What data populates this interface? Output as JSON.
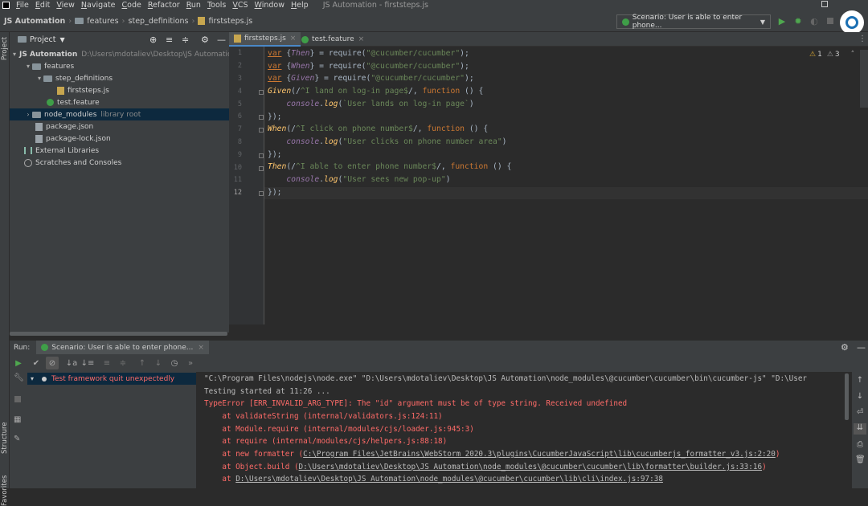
{
  "menu": [
    "File",
    "Edit",
    "View",
    "Navigate",
    "Code",
    "Refactor",
    "Run",
    "Tools",
    "VCS",
    "Window",
    "Help"
  ],
  "window_title": "JS Automation - firststeps.js",
  "breadcrumbs": [
    "JS Automation",
    "features",
    "step_definitions",
    "firststeps.js"
  ],
  "run_config": "Scenario: User is able to enter phone...",
  "project": {
    "header": "Project",
    "tree": [
      {
        "label": "JS Automation",
        "extra": "D:\\Users\\mdotaliev\\Desktop\\JS Automation",
        "type": "folder",
        "arrow": "▾",
        "indent": 0
      },
      {
        "label": "features",
        "extra": "",
        "type": "folder",
        "arrow": "▾",
        "indent": 1
      },
      {
        "label": "step_definitions",
        "extra": "",
        "type": "folder",
        "arrow": "▾",
        "indent": 2
      },
      {
        "label": "firststeps.js",
        "extra": "",
        "type": "js",
        "arrow": "",
        "indent": 3
      },
      {
        "label": "test.feature",
        "extra": "",
        "type": "feature",
        "arrow": "",
        "indent": 2
      },
      {
        "label": "node_modules",
        "extra": "library root",
        "type": "folder",
        "arrow": "›",
        "indent": 1
      },
      {
        "label": "package.json",
        "extra": "",
        "type": "json",
        "arrow": "",
        "indent": 1
      },
      {
        "label": "package-lock.json",
        "extra": "",
        "type": "json",
        "arrow": "",
        "indent": 1
      },
      {
        "label": "External Libraries",
        "extra": "",
        "type": "lib",
        "arrow": "",
        "indent": 0
      },
      {
        "label": "Scratches and Consoles",
        "extra": "",
        "type": "scratch",
        "arrow": "",
        "indent": 0
      }
    ]
  },
  "tabs": [
    {
      "label": "firststeps.js",
      "active": true
    },
    {
      "label": "test.feature",
      "active": false
    }
  ],
  "inspections": {
    "warnings": "1",
    "weak": "3"
  },
  "line_numbers": [
    "1",
    "2",
    "3",
    "4",
    "5",
    "6",
    "7",
    "8",
    "9",
    "10",
    "11",
    "12"
  ],
  "code": [
    "var {Then} = require(\"@cucumber/cucumber\");",
    "var {When} = require(\"@cucumber/cucumber\");",
    "var {Given} = require(\"@cucumber/cucumber\");",
    "Given(/^I land on log-in page$/, function () {",
    "    console.log(`User lands on log-in page`)",
    "});",
    "When(/^I click on phone number$/, function () {",
    "    console.log(\"User clicks on phone number area\")",
    "});",
    "Then(/^I able to enter phone number$/, function () {",
    "    console.log(\"User sees new pop-up\")",
    "});"
  ],
  "run": {
    "label": "Run:",
    "tab": "Scenario: User is able to enter phone...",
    "test_status": "Test framework quit unexpectedly",
    "console": [
      "\"C:\\Program Files\\nodejs\\node.exe\" \"D:\\Users\\mdotaliev\\Desktop\\JS Automation\\node_modules\\@cucumber\\cucumber\\bin\\cucumber-js\" \"D:\\User",
      "Testing started at 11:26 ...",
      "TypeError [ERR_INVALID_ARG_TYPE]: The \"id\" argument must be of type string. Received undefined",
      "    at validateString (internal/validators.js:124:11)",
      "    at Module.require (internal/modules/cjs/loader.js:945:3)",
      "    at require (internal/modules/cjs/helpers.js:88:18)",
      "    at new formatter (",
      "C:\\Program Files\\JetBrains\\WebStorm 2020.3\\plugins\\CucumberJavaScript\\lib\\cucumberjs_formatter_v3.js:2:20",
      ")",
      "    at Object.build (",
      "D:\\Users\\mdotaliev\\Desktop\\JS Automation\\node_modules\\@cucumber\\cucumber\\lib\\formatter\\builder.js:33:16",
      ")",
      "    at ",
      "D:\\Users\\mdotaliev\\Desktop\\JS Automation\\node_modules\\@cucumber\\cucumber\\lib\\cli\\index.js:97:38"
    ]
  },
  "side_labels": {
    "project": "Project",
    "structure": "Structure",
    "favorites": "Favorites"
  },
  "colors": {
    "error": "#ff6b68",
    "default": "#bbbbbb",
    "link": "#bbbbbb",
    "accent": "#4a88c7"
  }
}
